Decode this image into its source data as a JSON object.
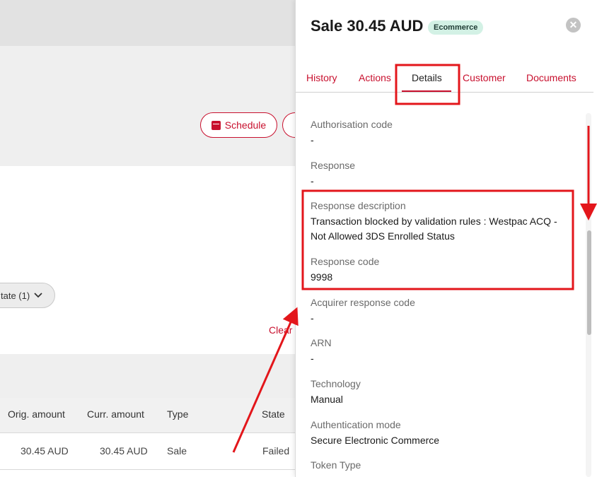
{
  "background": {
    "schedule_label": "Schedule",
    "state_filter_label": "tate (1)",
    "clear_label": "Clear",
    "table": {
      "headers": [
        "Orig. amount",
        "Curr. amount",
        "Type",
        "State"
      ],
      "row": [
        "30.45 AUD",
        "30.45 AUD",
        "Sale",
        "Failed"
      ]
    }
  },
  "panel": {
    "title": "Sale 30.45 AUD",
    "badge": "Ecommerce",
    "close_icon": "close-icon",
    "tabs": [
      {
        "label": "History"
      },
      {
        "label": "Actions"
      },
      {
        "label": "Details"
      },
      {
        "label": "Customer"
      },
      {
        "label": "Documents"
      }
    ],
    "active_tab": "Details",
    "fields": [
      {
        "label": "Authorisation code",
        "value": "-"
      },
      {
        "label": "Response",
        "value": "-"
      },
      {
        "label": "Response description",
        "value": "Transaction blocked by validation rules : Westpac ACQ - Not Allowed 3DS Enrolled Status"
      },
      {
        "label": "Response code",
        "value": "9998"
      },
      {
        "label": "Acquirer response code",
        "value": "-"
      },
      {
        "label": "ARN",
        "value": "-"
      },
      {
        "label": "Technology",
        "value": "Manual"
      },
      {
        "label": "Authentication mode",
        "value": "Secure Electronic Commerce"
      },
      {
        "label": "Token Type",
        "value": ""
      }
    ]
  },
  "colors": {
    "accent": "#c8102e",
    "badge_bg": "#d3f1e5",
    "annotation": "#e3161b"
  }
}
